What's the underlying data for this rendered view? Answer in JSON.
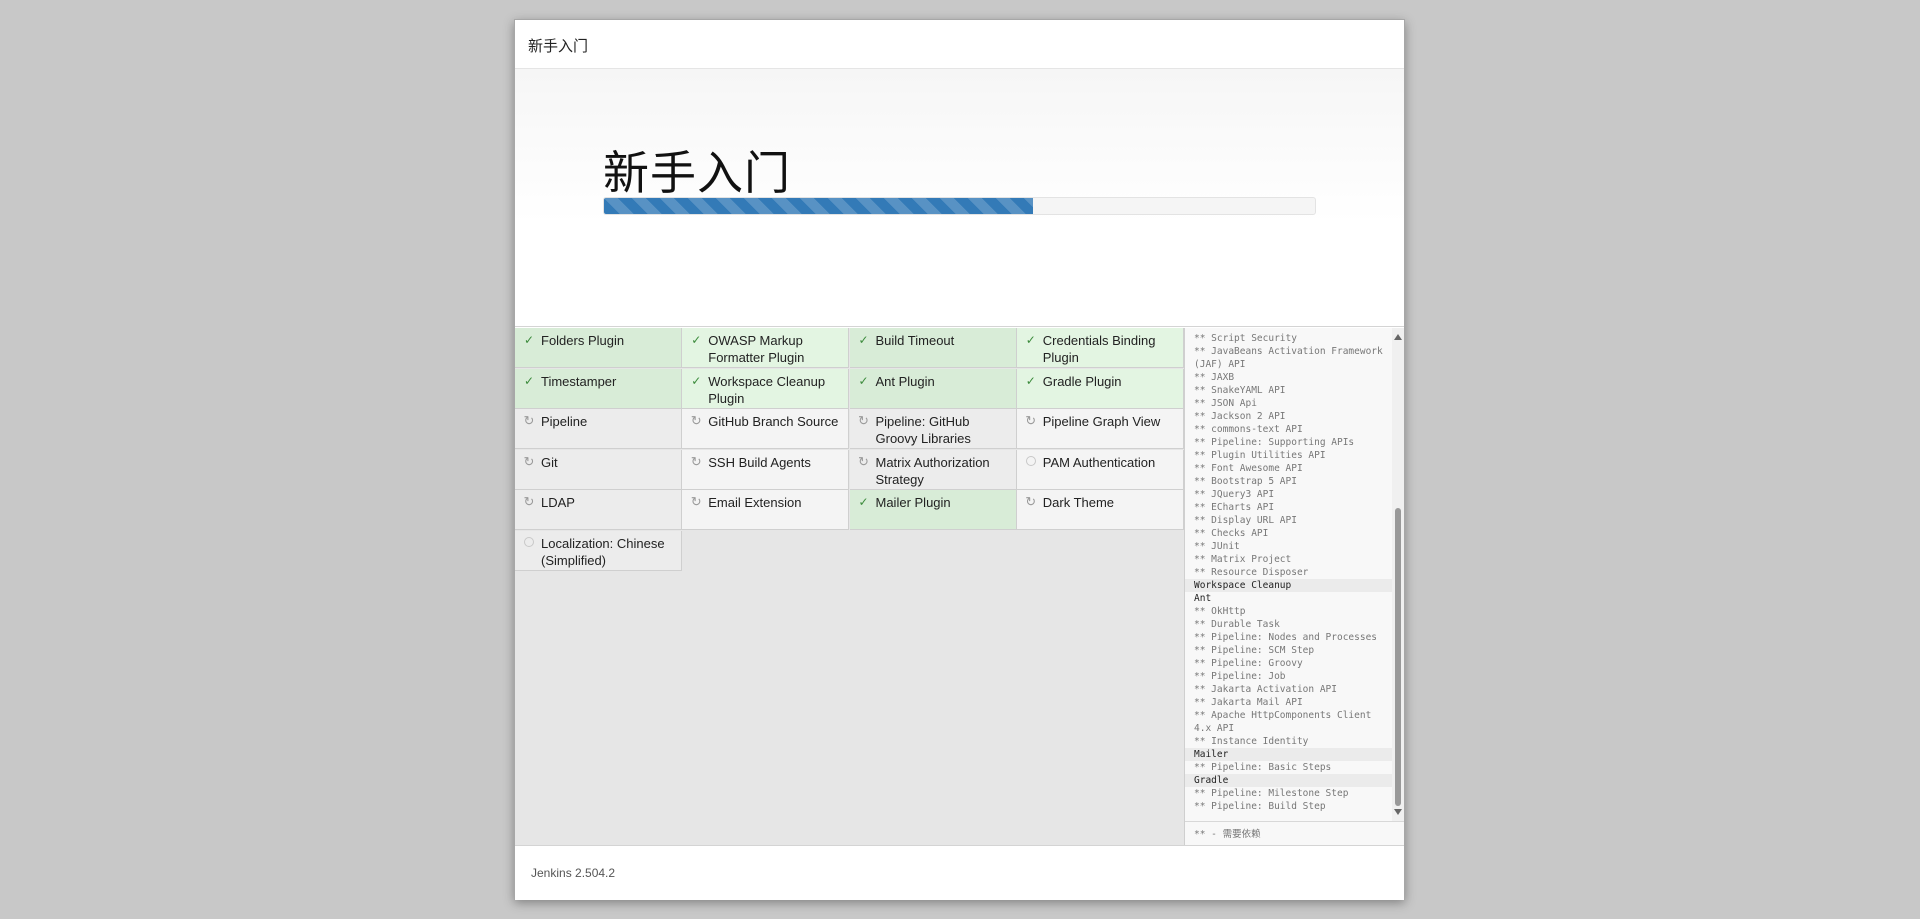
{
  "dialog": {
    "header_title": "新手入门",
    "hero_title": "新手入门",
    "progress_fraction": 0.604,
    "footer_version": "Jenkins 2.504.2"
  },
  "plugins": [
    {
      "name": "Folders Plugin",
      "status": "done"
    },
    {
      "name": "OWASP Markup Formatter Plugin",
      "status": "done"
    },
    {
      "name": "Build Timeout",
      "status": "done"
    },
    {
      "name": "Credentials Binding Plugin",
      "status": "done"
    },
    {
      "name": "Timestamper",
      "status": "done"
    },
    {
      "name": "Workspace Cleanup Plugin",
      "status": "done"
    },
    {
      "name": "Ant Plugin",
      "status": "done"
    },
    {
      "name": "Gradle Plugin",
      "status": "done"
    },
    {
      "name": "Pipeline",
      "status": "installing"
    },
    {
      "name": "GitHub Branch Source",
      "status": "installing"
    },
    {
      "name": "Pipeline: GitHub Groovy Libraries",
      "status": "installing"
    },
    {
      "name": "Pipeline Graph View",
      "status": "installing"
    },
    {
      "name": "Git",
      "status": "installing"
    },
    {
      "name": "SSH Build Agents",
      "status": "installing"
    },
    {
      "name": "Matrix Authorization Strategy",
      "status": "installing"
    },
    {
      "name": "PAM Authentication",
      "status": "pending"
    },
    {
      "name": "LDAP",
      "status": "installing"
    },
    {
      "name": "Email Extension",
      "status": "installing"
    },
    {
      "name": "Mailer Plugin",
      "status": "done"
    },
    {
      "name": "Dark Theme",
      "status": "installing"
    },
    {
      "name": "Localization: Chinese (Simplified)",
      "status": "pending"
    }
  ],
  "log": {
    "lines": [
      {
        "text": "** Script Security",
        "kind": "dep"
      },
      {
        "text": "** JavaBeans Activation Framework (JAF) API",
        "kind": "dep"
      },
      {
        "text": "** JAXB",
        "kind": "dep"
      },
      {
        "text": "** SnakeYAML API",
        "kind": "dep"
      },
      {
        "text": "** JSON Api",
        "kind": "dep"
      },
      {
        "text": "** Jackson 2 API",
        "kind": "dep"
      },
      {
        "text": "** commons-text API",
        "kind": "dep"
      },
      {
        "text": "** Pipeline: Supporting APIs",
        "kind": "dep"
      },
      {
        "text": "** Plugin Utilities API",
        "kind": "dep"
      },
      {
        "text": "** Font Awesome API",
        "kind": "dep"
      },
      {
        "text": "** Bootstrap 5 API",
        "kind": "dep"
      },
      {
        "text": "** JQuery3 API",
        "kind": "dep"
      },
      {
        "text": "** ECharts API",
        "kind": "dep"
      },
      {
        "text": "** Display URL API",
        "kind": "dep"
      },
      {
        "text": "** Checks API",
        "kind": "dep"
      },
      {
        "text": "** JUnit",
        "kind": "dep"
      },
      {
        "text": "** Matrix Project",
        "kind": "dep"
      },
      {
        "text": "** Resource Disposer",
        "kind": "dep"
      },
      {
        "text": "Workspace Cleanup",
        "kind": "main"
      },
      {
        "text": "Ant",
        "kind": "plain"
      },
      {
        "text": "** OkHttp",
        "kind": "dep"
      },
      {
        "text": "** Durable Task",
        "kind": "dep"
      },
      {
        "text": "** Pipeline: Nodes and Processes",
        "kind": "dep"
      },
      {
        "text": "** Pipeline: SCM Step",
        "kind": "dep"
      },
      {
        "text": "** Pipeline: Groovy",
        "kind": "dep"
      },
      {
        "text": "** Pipeline: Job",
        "kind": "dep"
      },
      {
        "text": "** Jakarta Activation API",
        "kind": "dep"
      },
      {
        "text": "** Jakarta Mail API",
        "kind": "dep"
      },
      {
        "text": "** Apache HttpComponents Client 4.x API",
        "kind": "dep"
      },
      {
        "text": "** Instance Identity",
        "kind": "dep"
      },
      {
        "text": "Mailer",
        "kind": "main"
      },
      {
        "text": "** Pipeline: Basic Steps",
        "kind": "dep"
      },
      {
        "text": "Gradle",
        "kind": "main"
      },
      {
        "text": "** Pipeline: Milestone Step",
        "kind": "dep"
      },
      {
        "text": "** Pipeline: Build Step",
        "kind": "dep"
      }
    ],
    "legend": "** - 需要依赖"
  },
  "colors": {
    "progress": "#337ab7",
    "done_bg": "#d8ecd7",
    "done_check": "#3c8b3c",
    "pending_bg": "#ececec"
  },
  "icons": {
    "done": "checkmark-icon",
    "installing": "spinner-icon",
    "pending": "empty-circle-icon"
  }
}
